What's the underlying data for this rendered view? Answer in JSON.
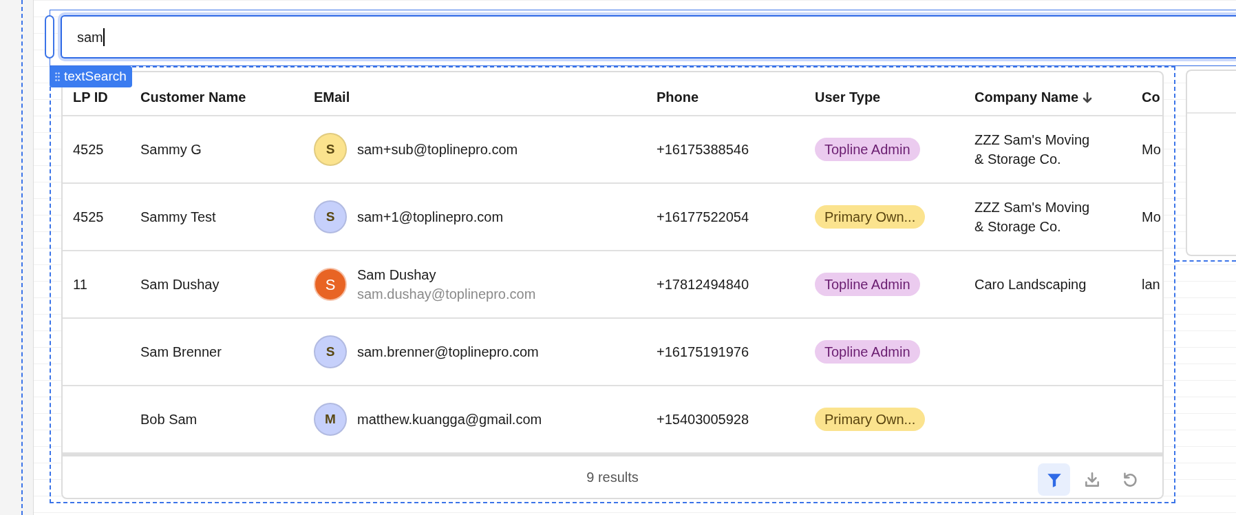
{
  "search": {
    "value": "sam",
    "tag": "textSearch"
  },
  "table": {
    "columns": [
      {
        "label": "LP ID",
        "sorted": false
      },
      {
        "label": "Customer Name",
        "sorted": false
      },
      {
        "label": "EMail",
        "sorted": false
      },
      {
        "label": "Phone",
        "sorted": false
      },
      {
        "label": "User Type",
        "sorted": false
      },
      {
        "label": "Company Name",
        "sorted": true
      },
      {
        "label": "Co",
        "sorted": false
      }
    ],
    "rows": [
      {
        "lp_id": "4525",
        "customer_name": "Sammy G",
        "avatar": {
          "letter": "S",
          "color": "#fbe38e"
        },
        "email": {
          "address": "sam+sub@toplinepro.com"
        },
        "phone": "+16175388546",
        "user_type": {
          "label": "Topline Admin",
          "color": "#ebcbef"
        },
        "company_name": "ZZZ Sam's Moving & Storage Co.",
        "column_7": "Mo"
      },
      {
        "lp_id": "4525",
        "customer_name": "Sammy Test",
        "avatar": {
          "letter": "S",
          "color": "#c6d0fb"
        },
        "email": {
          "address": "sam+1@toplinepro.com"
        },
        "phone": "+16177522054",
        "user_type": {
          "label": "Primary Own...",
          "color": "#fbe38e"
        },
        "company_name": "ZZZ Sam's Moving & Storage Co.",
        "column_7": "Mo"
      },
      {
        "lp_id": "11",
        "customer_name": "Sam Dushay",
        "avatar": {
          "letter": "S",
          "color": "#e86424"
        },
        "email": {
          "name": "Sam Dushay",
          "address": "sam.dushay@toplinepro.com"
        },
        "phone": "+17812494840",
        "user_type": {
          "label": "Topline Admin",
          "color": "#ebcbef"
        },
        "company_name": "Caro Landscaping",
        "column_7": "lan"
      },
      {
        "customer_name": "Sam Brenner",
        "avatar": {
          "letter": "S",
          "color": "#c6d0fb"
        },
        "email": {
          "address": "sam.brenner@toplinepro.com"
        },
        "phone": "+16175191976",
        "user_type": {
          "label": "Topline Admin",
          "color": "#ebcbef"
        }
      },
      {
        "customer_name": "Bob Sam",
        "avatar": {
          "letter": "M",
          "color": "#c6d0fb"
        },
        "email": {
          "address": "matthew.kuangga@gmail.com"
        },
        "phone": "+15403005928",
        "user_type": {
          "label": "Primary Own...",
          "color": "#fbe38e"
        }
      }
    ]
  },
  "footer": {
    "results": "9 results",
    "tools": [
      {
        "kind": "filter",
        "selected": true
      },
      {
        "kind": "download",
        "selected": false
      },
      {
        "kind": "reset",
        "selected": false
      }
    ]
  }
}
